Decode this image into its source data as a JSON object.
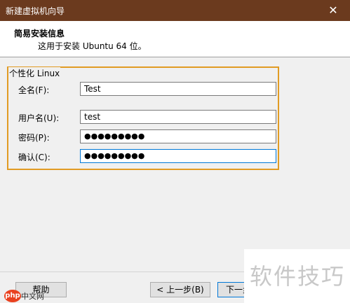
{
  "window": {
    "title": "新建虚拟机向导",
    "close_label": "✕"
  },
  "header": {
    "title": "简易安装信息",
    "subtitle": "这用于安装 Ubuntu 64 位。"
  },
  "group": {
    "label": "个性化 Linux"
  },
  "fields": {
    "fullname": {
      "label": "全名(F):",
      "value": "Test"
    },
    "username": {
      "label": "用户名(U):",
      "value": "test"
    },
    "password": {
      "label": "密码(P):",
      "value": "●●●●●●●●●"
    },
    "confirm": {
      "label": "确认(C):",
      "value": "●●●●●●●●●"
    }
  },
  "buttons": {
    "help": "帮助",
    "back": "< 上一步(B)",
    "next": "下一步"
  },
  "watermark": {
    "text": "软件技巧",
    "logo_p": "php",
    "logo_cn": "中文网"
  }
}
